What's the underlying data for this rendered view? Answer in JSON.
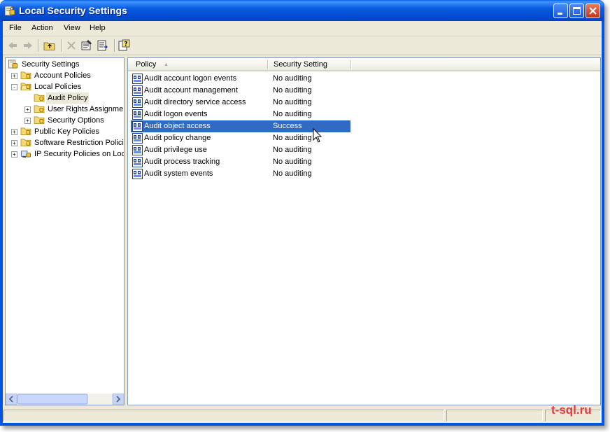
{
  "window": {
    "title": "Local Security Settings",
    "title_icon": "security-settings-icon",
    "buttons": [
      "minimize-button",
      "maximize-button",
      "close-button"
    ]
  },
  "menubar": {
    "items": [
      "File",
      "Action",
      "View",
      "Help"
    ]
  },
  "toolbar": {
    "buttons": [
      "back-arrow-icon",
      "forward-arrow-icon",
      "up-folder-icon",
      "delete-icon",
      "properties-icon",
      "export-list-icon",
      "help-icon"
    ]
  },
  "tree": {
    "items": [
      {
        "label": "Security Settings",
        "icon": "security-settings-icon",
        "expander": ""
      },
      {
        "label": "Account Policies",
        "icon": "folder-icon",
        "expander": "+"
      },
      {
        "label": "Local Policies",
        "icon": "folder-open-icon",
        "expander": "-"
      },
      {
        "label": "Audit Policy",
        "icon": "folder-icon",
        "expander": ""
      },
      {
        "label": "User Rights Assignmen",
        "icon": "folder-icon",
        "expander": "+"
      },
      {
        "label": "Security Options",
        "icon": "folder-icon",
        "expander": "+"
      },
      {
        "label": "Public Key Policies",
        "icon": "folder-icon",
        "expander": "+"
      },
      {
        "label": "Software Restriction Policie",
        "icon": "folder-icon",
        "expander": "+"
      },
      {
        "label": "IP Security Policies on Loca",
        "icon": "ip-security-icon",
        "expander": "+"
      }
    ],
    "selected": "Audit Policy"
  },
  "list": {
    "columns": [
      "Policy",
      "Security Setting"
    ],
    "sort_indicator": "▲",
    "rows": [
      {
        "policy": "Audit account logon events",
        "setting": "No auditing"
      },
      {
        "policy": "Audit account management",
        "setting": "No auditing"
      },
      {
        "policy": "Audit directory service access",
        "setting": "No auditing"
      },
      {
        "policy": "Audit logon events",
        "setting": "No auditing"
      },
      {
        "policy": "Audit object access",
        "setting": "Success"
      },
      {
        "policy": "Audit policy change",
        "setting": "No auditing"
      },
      {
        "policy": "Audit privilege use",
        "setting": "No auditing"
      },
      {
        "policy": "Audit process tracking",
        "setting": "No auditing"
      },
      {
        "policy": "Audit system events",
        "setting": "No auditing"
      }
    ],
    "selected_row": "Audit object access",
    "row_icon": "audit-policy-icon"
  },
  "colors": {
    "selection": "#316ac5",
    "titlebar": "#0054e3",
    "watermark": "#e63b3b"
  },
  "watermark": "t-sql.ru"
}
